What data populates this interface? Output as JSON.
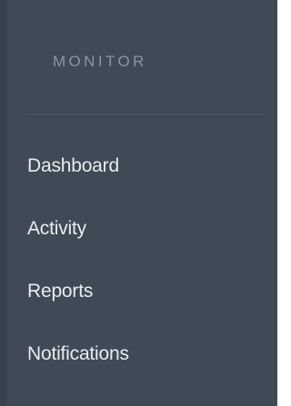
{
  "sidebar": {
    "section_title": "MONITOR",
    "items": [
      {
        "label": "Dashboard"
      },
      {
        "label": "Activity"
      },
      {
        "label": "Reports"
      },
      {
        "label": "Notifications"
      }
    ]
  },
  "colors": {
    "sidebar_background": "#3e4a56",
    "heading_text": "#8a96a3",
    "item_text": "#e8eced"
  }
}
